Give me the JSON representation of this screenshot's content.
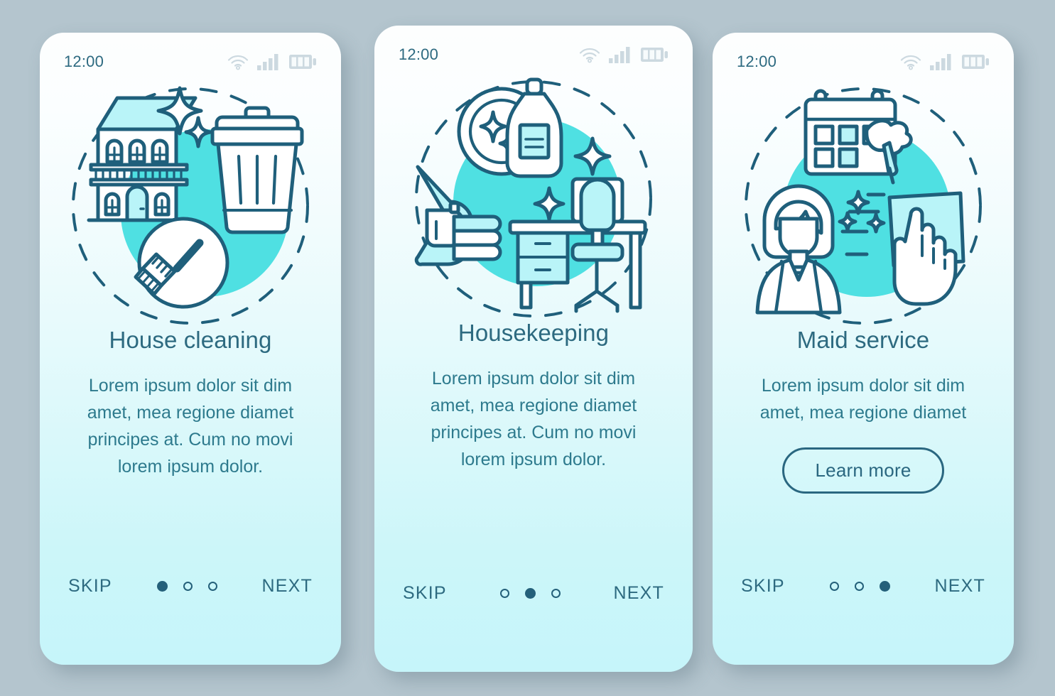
{
  "theme": {
    "page_background": "#b4c5ce",
    "card_top": "#fdfefe",
    "card_bottom": "#c6f5fa",
    "accent_cyan": "#4fe0e2",
    "stroke_dark": "#1f5f7b",
    "title_color": "#2d6a80",
    "body_color": "#2d7a8d",
    "status_icon_color": "#ccd9e0"
  },
  "screens": [
    {
      "status": {
        "time": "12:00",
        "icons": [
          "wifi-icon",
          "cellular-signal-icon",
          "battery-icon"
        ]
      },
      "illustration": {
        "name": "house-cleaning-illustration",
        "elements": [
          "house",
          "sparkle",
          "trash-bin",
          "broom-badge",
          "dashed-circle",
          "cyan-blob"
        ]
      },
      "title": "House cleaning",
      "description": "Lorem ipsum dolor sit dim amet, mea regione diamet principes at. Cum no movi lorem ipsum dolor.",
      "cta": null,
      "footer": {
        "skip_label": "SKIP",
        "next_label": "NEXT",
        "dots_total": 3,
        "dot_active_index": 0
      }
    },
    {
      "status": {
        "time": "12:00",
        "icons": [
          "wifi-icon",
          "cellular-signal-icon",
          "battery-icon"
        ]
      },
      "illustration": {
        "name": "housekeeping-illustration",
        "elements": [
          "clean-plate",
          "detergent-bottle",
          "sparkle",
          "iron",
          "folded-towels",
          "desk",
          "office-chair",
          "dashed-circle",
          "cyan-blob"
        ]
      },
      "title": "Housekeeping",
      "description": "Lorem ipsum dolor sit dim amet, mea regione diamet principes at. Cum no movi lorem ipsum dolor.",
      "cta": null,
      "footer": {
        "skip_label": "SKIP",
        "next_label": "NEXT",
        "dots_total": 3,
        "dot_active_index": 1
      }
    },
    {
      "status": {
        "time": "12:00",
        "icons": [
          "wifi-icon",
          "cellular-signal-icon",
          "battery-icon"
        ]
      },
      "illustration": {
        "name": "maid-service-illustration",
        "elements": [
          "calendar",
          "feather-duster",
          "maid-woman",
          "cleaning-cloth",
          "hand",
          "sparkle",
          "dashed-circle",
          "cyan-blob"
        ]
      },
      "title": "Maid service",
      "description": "Lorem ipsum dolor sit dim amet, mea regione diamet",
      "cta": {
        "label": "Learn more"
      },
      "footer": {
        "skip_label": "SKIP",
        "next_label": "NEXT",
        "dots_total": 3,
        "dot_active_index": 2
      }
    }
  ]
}
